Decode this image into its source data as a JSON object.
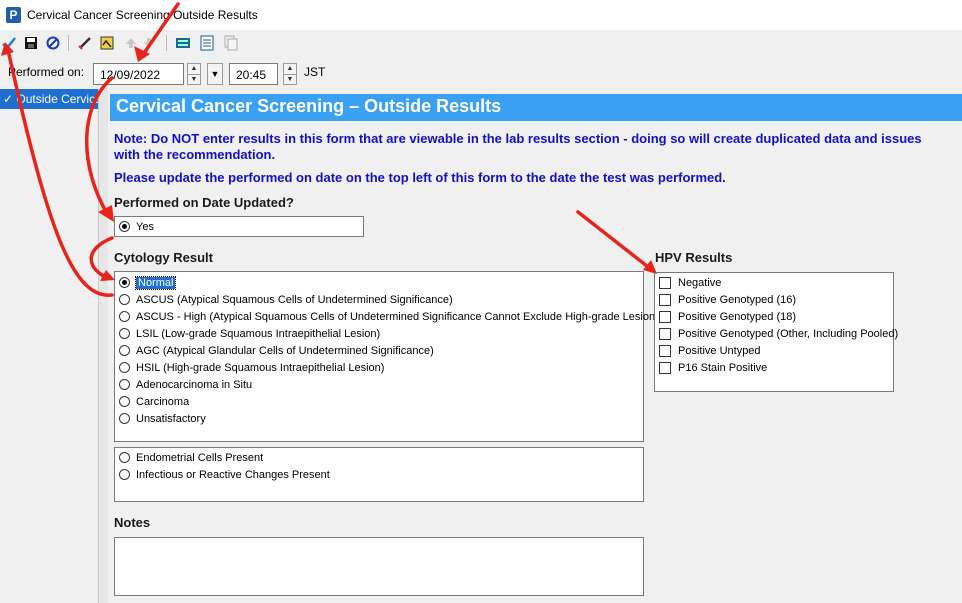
{
  "window": {
    "title": "Cervical Cancer Screening Outside Results",
    "app_icon_letter": "P"
  },
  "toolbar": {
    "icons": [
      "checkmark-icon",
      "save-icon",
      "cancel-icon",
      "pen-icon",
      "sign-icon",
      "up-arrow-icon",
      "down-arrow-icon",
      "calculator-icon",
      "form-icon",
      "copy-icon"
    ]
  },
  "performed": {
    "label": "Performed on:",
    "date": "12/09/2022",
    "time": "20:45",
    "timezone": "JST"
  },
  "nav": {
    "item": "Outside Cervical C"
  },
  "form": {
    "header": "Cervical Cancer Screening – Outside Results",
    "note1": "Note: Do NOT enter results in this form that are viewable in the lab results section - doing so will create duplicated data and issues with the recommendation.",
    "note2": "Please update the performed on date on the top left of this form to the date the test was performed.",
    "performed_updated": {
      "label": "Performed on Date Updated?",
      "options": [
        "Yes"
      ],
      "selected": 0
    },
    "cytology": {
      "label": "Cytology Result",
      "options": [
        "Normal",
        "ASCUS (Atypical Squamous Cells of Undetermined Significance)",
        "ASCUS - High (Atypical Squamous Cells of Undetermined Significance Cannot Exclude High-grade Lesion)",
        "LSIL (Low-grade Squamous Intraepithelial Lesion)",
        "AGC (Atypical Glandular Cells of Undetermined Significance)",
        "HSIL (High-grade Squamous Intraepithelial Lesion)",
        "Adenocarcinoma in Situ",
        "Carcinoma",
        "Unsatisfactory"
      ],
      "selected": 0
    },
    "additional": {
      "options": [
        "Endometrial Cells Present",
        "Infectious or Reactive Changes Present"
      ]
    },
    "hpv": {
      "label": "HPV Results",
      "options": [
        "Negative",
        "Positive Genotyped (16)",
        "Positive Genotyped (18)",
        "Positive Genotyped (Other, Including Pooled)",
        "Positive Untyped",
        "P16 Stain Positive"
      ]
    },
    "notes": {
      "label": "Notes",
      "value": ""
    }
  },
  "colors": {
    "header_bg": "#3aa1f2",
    "note_text": "#1010c8",
    "selection": "#1e6fd0",
    "annotation_arrow": "#e8231b"
  }
}
